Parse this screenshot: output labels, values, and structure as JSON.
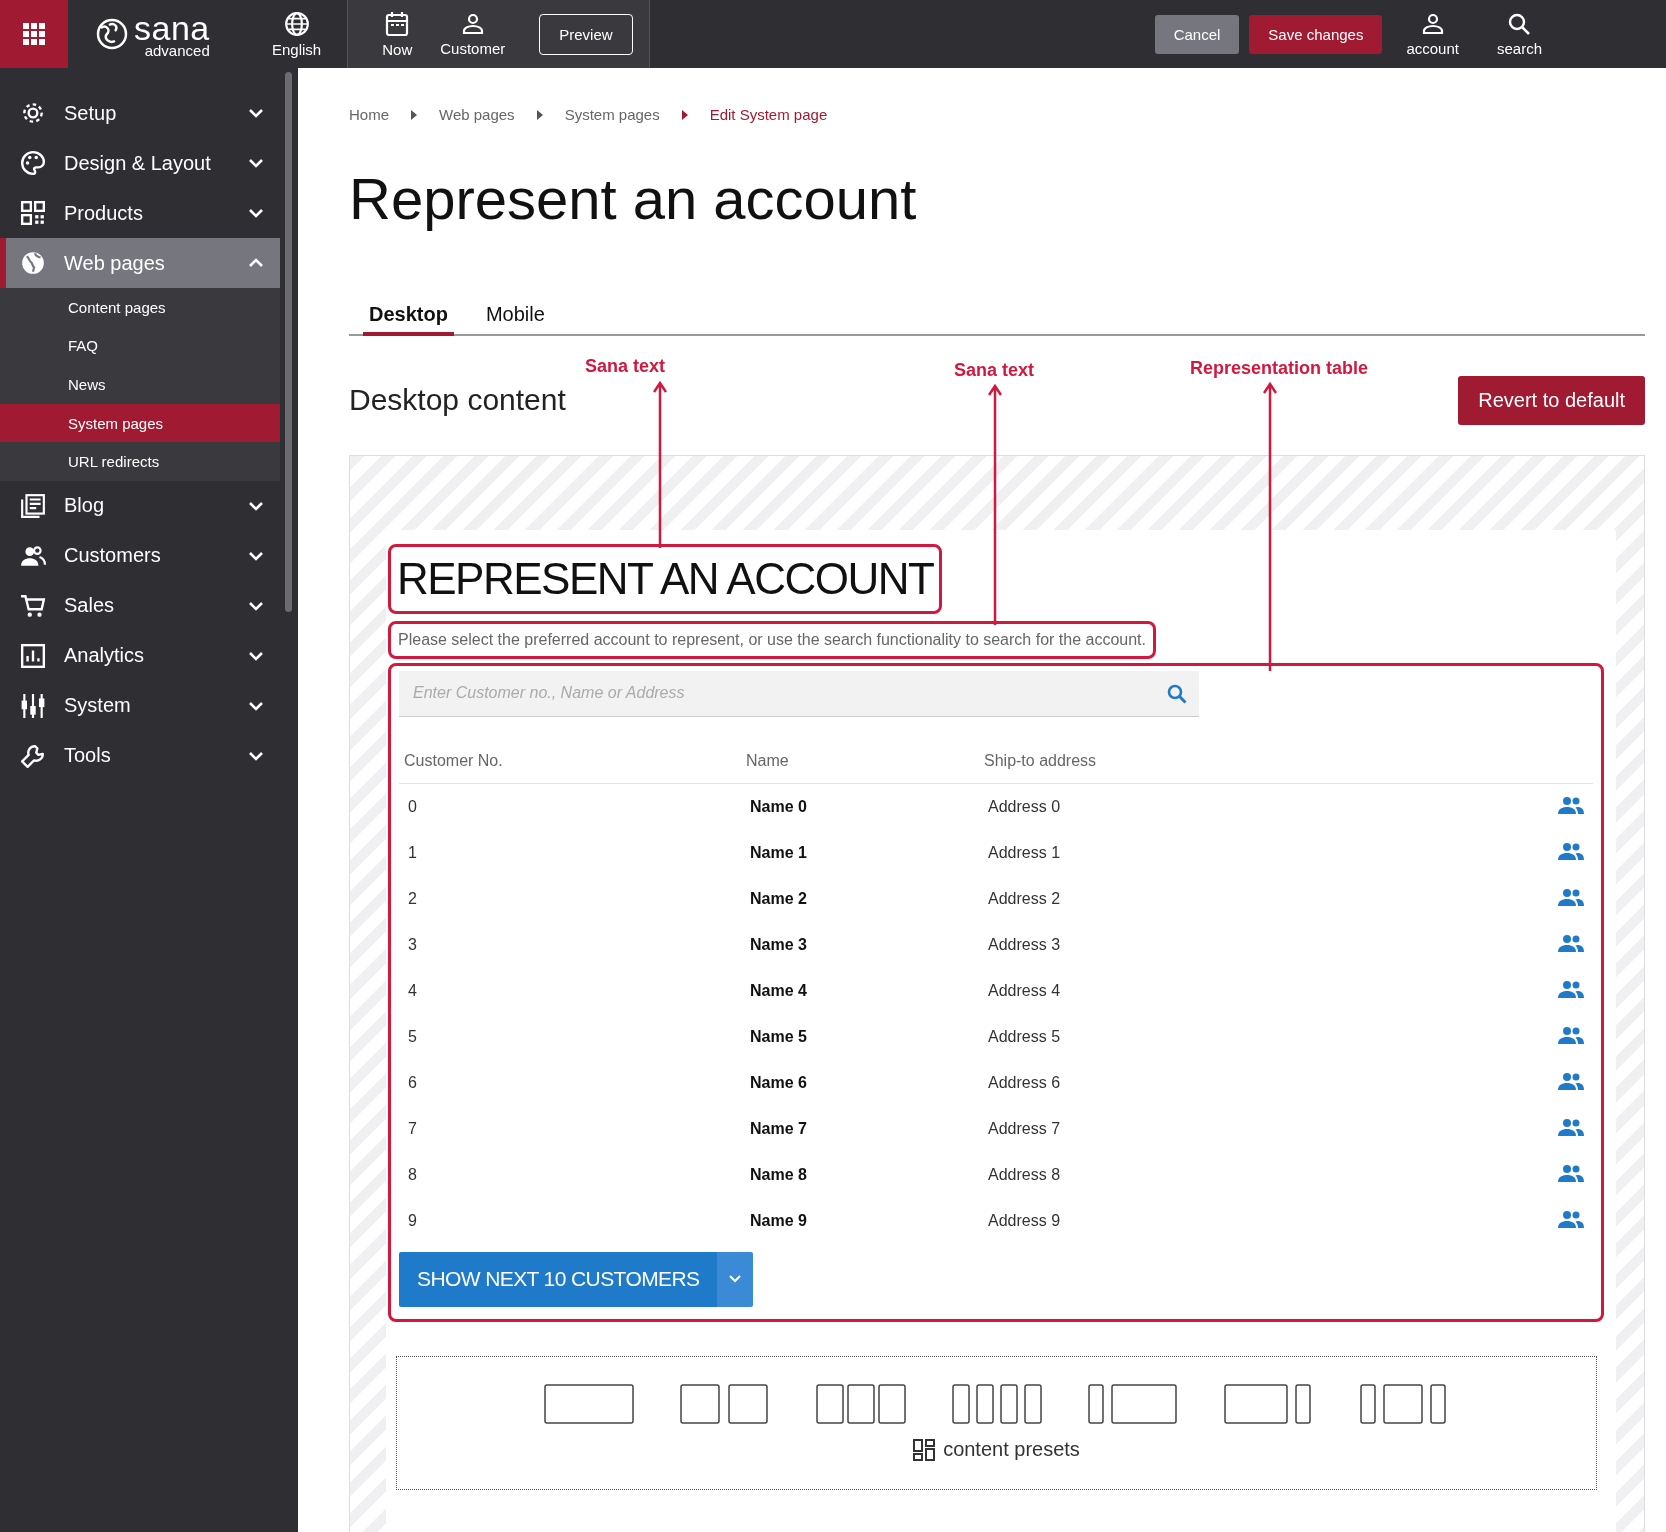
{
  "topbar": {
    "logo_name": "sana",
    "logo_sub": "advanced",
    "language": "English",
    "date_button": "Now",
    "customer_button": "Customer",
    "preview_button": "Preview",
    "cancel_button": "Cancel",
    "save_button": "Save changes",
    "account_button": "account",
    "search_button": "search"
  },
  "sidebar": {
    "items": [
      {
        "label": "Setup",
        "expanded": false,
        "selected": false
      },
      {
        "label": "Design & Layout",
        "expanded": false,
        "selected": false
      },
      {
        "label": "Products",
        "expanded": false,
        "selected": false
      },
      {
        "label": "Web pages",
        "expanded": true,
        "selected": true,
        "children": [
          {
            "label": "Content pages",
            "selected": false
          },
          {
            "label": "FAQ",
            "selected": false
          },
          {
            "label": "News",
            "selected": false
          },
          {
            "label": "System pages",
            "selected": true
          },
          {
            "label": "URL redirects",
            "selected": false
          }
        ]
      },
      {
        "label": "Blog",
        "expanded": false,
        "selected": false
      },
      {
        "label": "Customers",
        "expanded": false,
        "selected": false
      },
      {
        "label": "Sales",
        "expanded": false,
        "selected": false
      },
      {
        "label": "Analytics",
        "expanded": false,
        "selected": false
      },
      {
        "label": "System",
        "expanded": false,
        "selected": false
      },
      {
        "label": "Tools",
        "expanded": false,
        "selected": false
      }
    ]
  },
  "breadcrumb": [
    {
      "label": "Home",
      "current": false
    },
    {
      "label": "Web pages",
      "current": false
    },
    {
      "label": "System pages",
      "current": false
    },
    {
      "label": "Edit System page",
      "current": true
    }
  ],
  "page_title": "Represent an account",
  "tabs": [
    {
      "label": "Desktop",
      "selected": true
    },
    {
      "label": "Mobile",
      "selected": false
    }
  ],
  "section_title": "Desktop content",
  "revert_button": "Revert to default",
  "annotations": [
    {
      "label": "Sana text"
    },
    {
      "label": "Sana text"
    },
    {
      "label": "Representation table"
    }
  ],
  "preview": {
    "heading": "REPRESENT AN ACCOUNT",
    "description": "Please select the preferred account to represent, or use the search functionality to search for the account.",
    "search": {
      "placeholder": "Enter Customer no., Name or Address"
    },
    "table": {
      "columns": [
        "Customer No.",
        "Name",
        "Ship-to address"
      ],
      "rows": [
        {
          "customer_no": "0",
          "name": "Name 0",
          "address": "Address 0"
        },
        {
          "customer_no": "1",
          "name": "Name 1",
          "address": "Address 1"
        },
        {
          "customer_no": "2",
          "name": "Name 2",
          "address": "Address 2"
        },
        {
          "customer_no": "3",
          "name": "Name 3",
          "address": "Address 3"
        },
        {
          "customer_no": "4",
          "name": "Name 4",
          "address": "Address 4"
        },
        {
          "customer_no": "5",
          "name": "Name 5",
          "address": "Address 5"
        },
        {
          "customer_no": "6",
          "name": "Name 6",
          "address": "Address 6"
        },
        {
          "customer_no": "7",
          "name": "Name 7",
          "address": "Address 7"
        },
        {
          "customer_no": "8",
          "name": "Name 8",
          "address": "Address 8"
        },
        {
          "customer_no": "9",
          "name": "Name 9",
          "address": "Address 9"
        }
      ]
    },
    "show_more_button": "SHOW NEXT 10 CUSTOMERS"
  },
  "content_presets": {
    "label": "content presets"
  }
}
